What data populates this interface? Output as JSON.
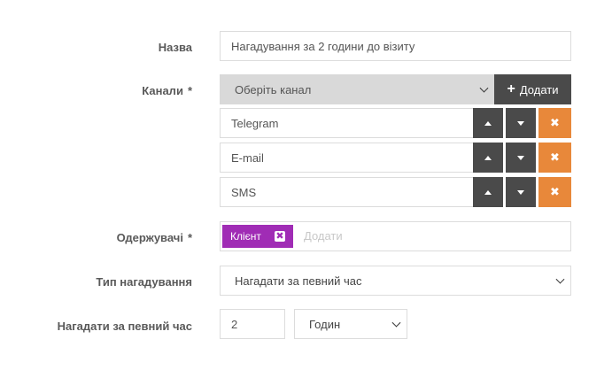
{
  "fields": {
    "name": {
      "label": "Назва",
      "value": "Нагадування за 2 години до візиту"
    },
    "channels": {
      "label": "Канали",
      "required_mark": "*",
      "select_placeholder": "Оберіть канал",
      "add_label": "Додати",
      "items": [
        {
          "name": "Telegram",
          "remove_glyph": "✖"
        },
        {
          "name": "E-mail",
          "remove_glyph": "✖"
        },
        {
          "name": "SMS",
          "remove_glyph": "✖"
        }
      ]
    },
    "recipients": {
      "label": "Одержувачі",
      "required_mark": "*",
      "tag": "Клієнт",
      "tag_remove_glyph": "✖",
      "placeholder": "Додати"
    },
    "reminder_type": {
      "label": "Тип нагадування",
      "value": "Нагадати за певний час"
    },
    "remind_before": {
      "label": "Нагадати за певний час",
      "amount": "2",
      "unit": "Годин"
    }
  },
  "colors": {
    "dark_button": "#4a4a4a",
    "remove_button": "#e8883a",
    "tag": "#a02cb5",
    "select_disabled_bg": "#d9d9d9"
  },
  "icons": {
    "add": "plus-icon",
    "up": "arrow-up-icon",
    "down": "arrow-down-icon",
    "remove": "close-icon"
  }
}
